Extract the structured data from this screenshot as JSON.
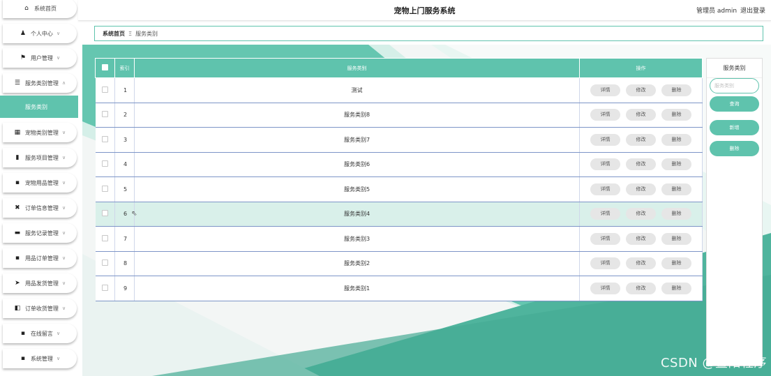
{
  "app": {
    "title": "宠物上门服务系统",
    "user_label": "管理员 admin",
    "logout": "退出登录"
  },
  "sidebar": {
    "items": [
      {
        "label": "系统首页",
        "icon": "home-icon",
        "glyph": "⌂",
        "chevron": ""
      },
      {
        "label": "个人中心",
        "icon": "user-icon",
        "glyph": "♟",
        "chevron": "∨"
      },
      {
        "label": "用户管理",
        "icon": "flag-icon",
        "glyph": "⚑",
        "chevron": "∨"
      },
      {
        "label": "服务类别管理",
        "icon": "sliders-icon",
        "glyph": "☰",
        "chevron": "∧"
      },
      {
        "label": "宠物类别管理",
        "icon": "clipboard-icon",
        "glyph": "▦",
        "chevron": "∨"
      },
      {
        "label": "服务项目管理",
        "icon": "bar-chart-icon",
        "glyph": "▮",
        "chevron": "∨"
      },
      {
        "label": "宠物用品管理",
        "icon": "grid-icon",
        "glyph": "▪",
        "chevron": "∨"
      },
      {
        "label": "订单信息管理",
        "icon": "ticket-icon",
        "glyph": "✖",
        "chevron": "∨"
      },
      {
        "label": "服务记录管理",
        "icon": "message-icon",
        "glyph": "▬",
        "chevron": "∨"
      },
      {
        "label": "用品订单管理",
        "icon": "grid-icon",
        "glyph": "▪",
        "chevron": "∨"
      },
      {
        "label": "用品发货管理",
        "icon": "send-icon",
        "glyph": "➤",
        "chevron": "∨"
      },
      {
        "label": "订单收货管理",
        "icon": "box-icon",
        "glyph": "◧",
        "chevron": "∨"
      },
      {
        "label": "在线留言",
        "icon": "grid-icon",
        "glyph": "▪",
        "chevron": "∨"
      },
      {
        "label": "系统管理",
        "icon": "grid-icon",
        "glyph": "▪",
        "chevron": "∨"
      }
    ],
    "active_sub": "服务类别"
  },
  "breadcrumb": {
    "home": "系统首页",
    "separator": "Ξ",
    "current": "服务类别"
  },
  "table": {
    "headers": {
      "index": "索引",
      "name": "服务类别",
      "actions": "操作"
    },
    "rows": [
      {
        "index": "1",
        "name": "测试"
      },
      {
        "index": "2",
        "name": "服务类别8"
      },
      {
        "index": "3",
        "name": "服务类别7"
      },
      {
        "index": "4",
        "name": "服务类别6"
      },
      {
        "index": "5",
        "name": "服务类别5"
      },
      {
        "index": "6",
        "name": "服务类别4"
      },
      {
        "index": "7",
        "name": "服务类别3"
      },
      {
        "index": "8",
        "name": "服务类别2"
      },
      {
        "index": "9",
        "name": "服务类别1"
      }
    ],
    "buttons": {
      "detail": "详情",
      "edit": "修改",
      "delete": "删除"
    }
  },
  "search_panel": {
    "title": "服务类别",
    "input_placeholder": "服务类别",
    "query": "查询",
    "add": "新增",
    "delete": "删除"
  },
  "watermark": "CSDN @暨阳程序",
  "colors": {
    "accent": "#5fc3ad",
    "row_highlight": "#d9f0ea"
  }
}
